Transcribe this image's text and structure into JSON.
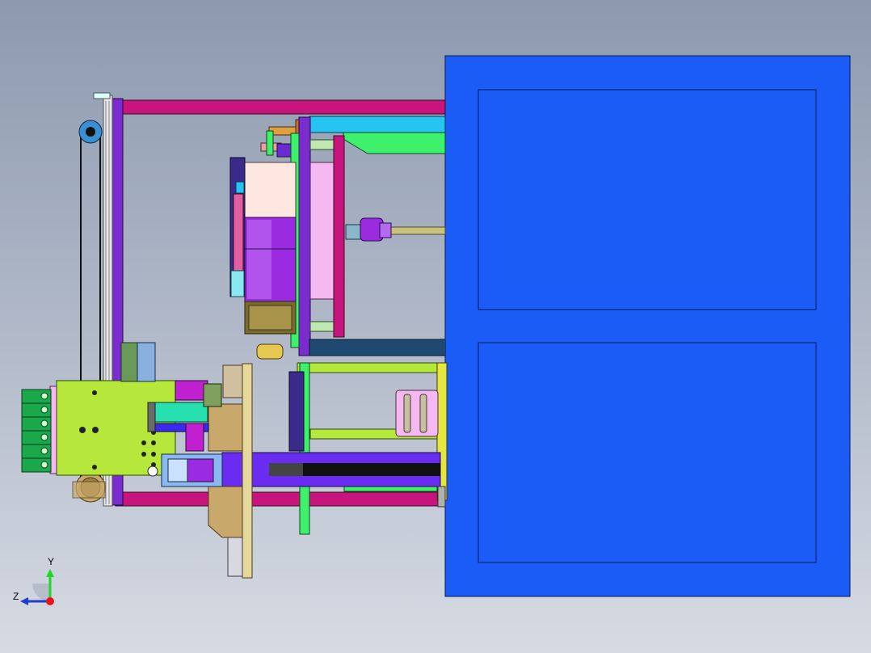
{
  "triad": {
    "y_label": "Y",
    "z_label": "Z"
  },
  "colors": {
    "background_top": "#8c99ae",
    "background_bottom": "#d6dbe3",
    "table_blue": "#1a5cf5",
    "frame_magenta": "#c8157e",
    "frame_purple": "#7a2ccf",
    "plate_lime": "#b5e83a",
    "bright_green": "#3ef06b",
    "cyan": "#26c4f0",
    "pink": "#f5b8f0",
    "motor_purple": "#9a2be0",
    "tan": "#c9a86b",
    "connector_green": "#1aa84a",
    "axis_y": "#1fd42a",
    "axis_z": "#1f3cd4",
    "axis_origin": "#e8131a"
  },
  "icons": [
    "view-orientation-triad-icon"
  ]
}
